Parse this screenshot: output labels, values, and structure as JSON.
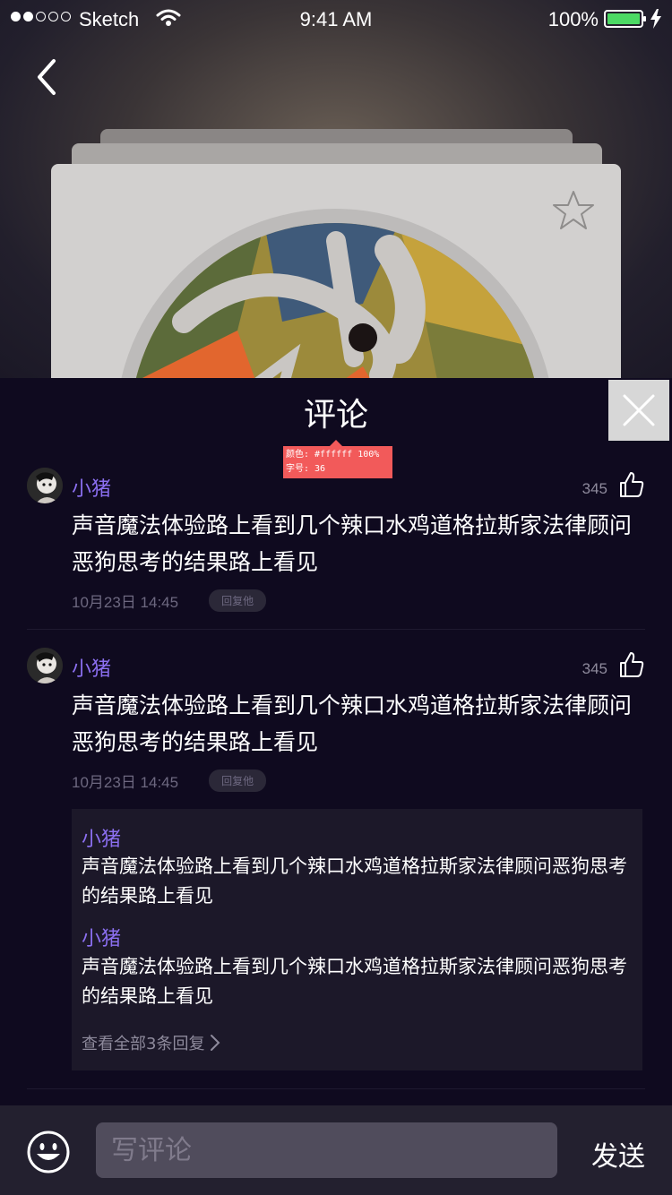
{
  "status_bar": {
    "carrier": "Sketch",
    "time": "9:41 AM",
    "battery": "100%"
  },
  "panel": {
    "title": "评论",
    "annotation_line1": "颜色: #ffffff 100%",
    "annotation_line2": "字号: 36"
  },
  "comments": [
    {
      "user": "小猪",
      "likes": "345",
      "text": "声音魔法体验路上看到几个辣口水鸡道格拉斯家法律顾问恶狗思考的结果路上看见",
      "time": "10月23日 14:45",
      "reply_label": "回复他"
    },
    {
      "user": "小猪",
      "likes": "345",
      "text": "声音魔法体验路上看到几个辣口水鸡道格拉斯家法律顾问恶狗思考的结果路上看见",
      "time": "10月23日 14:45",
      "reply_label": "回复他",
      "replies": [
        {
          "user": "小猪",
          "text": "声音魔法体验路上看到几个辣口水鸡道格拉斯家法律顾问恶狗思考的结果路上看见"
        },
        {
          "user": "小猪",
          "text": "声音魔法体验路上看到几个辣口水鸡道格拉斯家法律顾问恶狗思考的结果路上看见"
        }
      ],
      "view_all": "查看全部3条回复"
    }
  ],
  "bottom_bar": {
    "placeholder": "写评论",
    "send": "发送"
  },
  "colors": {
    "accent_username": "#8b6ff0",
    "panel_bg": "#0f0a1f",
    "annotation_bg": "#f25a5a"
  }
}
